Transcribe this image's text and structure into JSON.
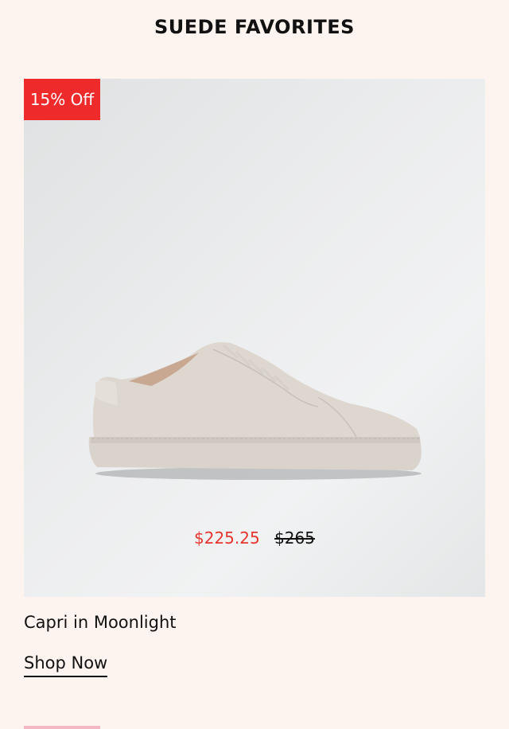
{
  "section": {
    "title": "SUEDE FAVORITES"
  },
  "product": {
    "badge": "15% Off",
    "image_icon": "sneaker-image",
    "sale_price": "$225.25",
    "original_price": "$265",
    "name": "Capri in Moonlight",
    "cta_label": "Shop Now"
  },
  "colors": {
    "background": "#fdf4f0",
    "badge": "#ee2a2a",
    "sale_price": "#e6352f"
  }
}
